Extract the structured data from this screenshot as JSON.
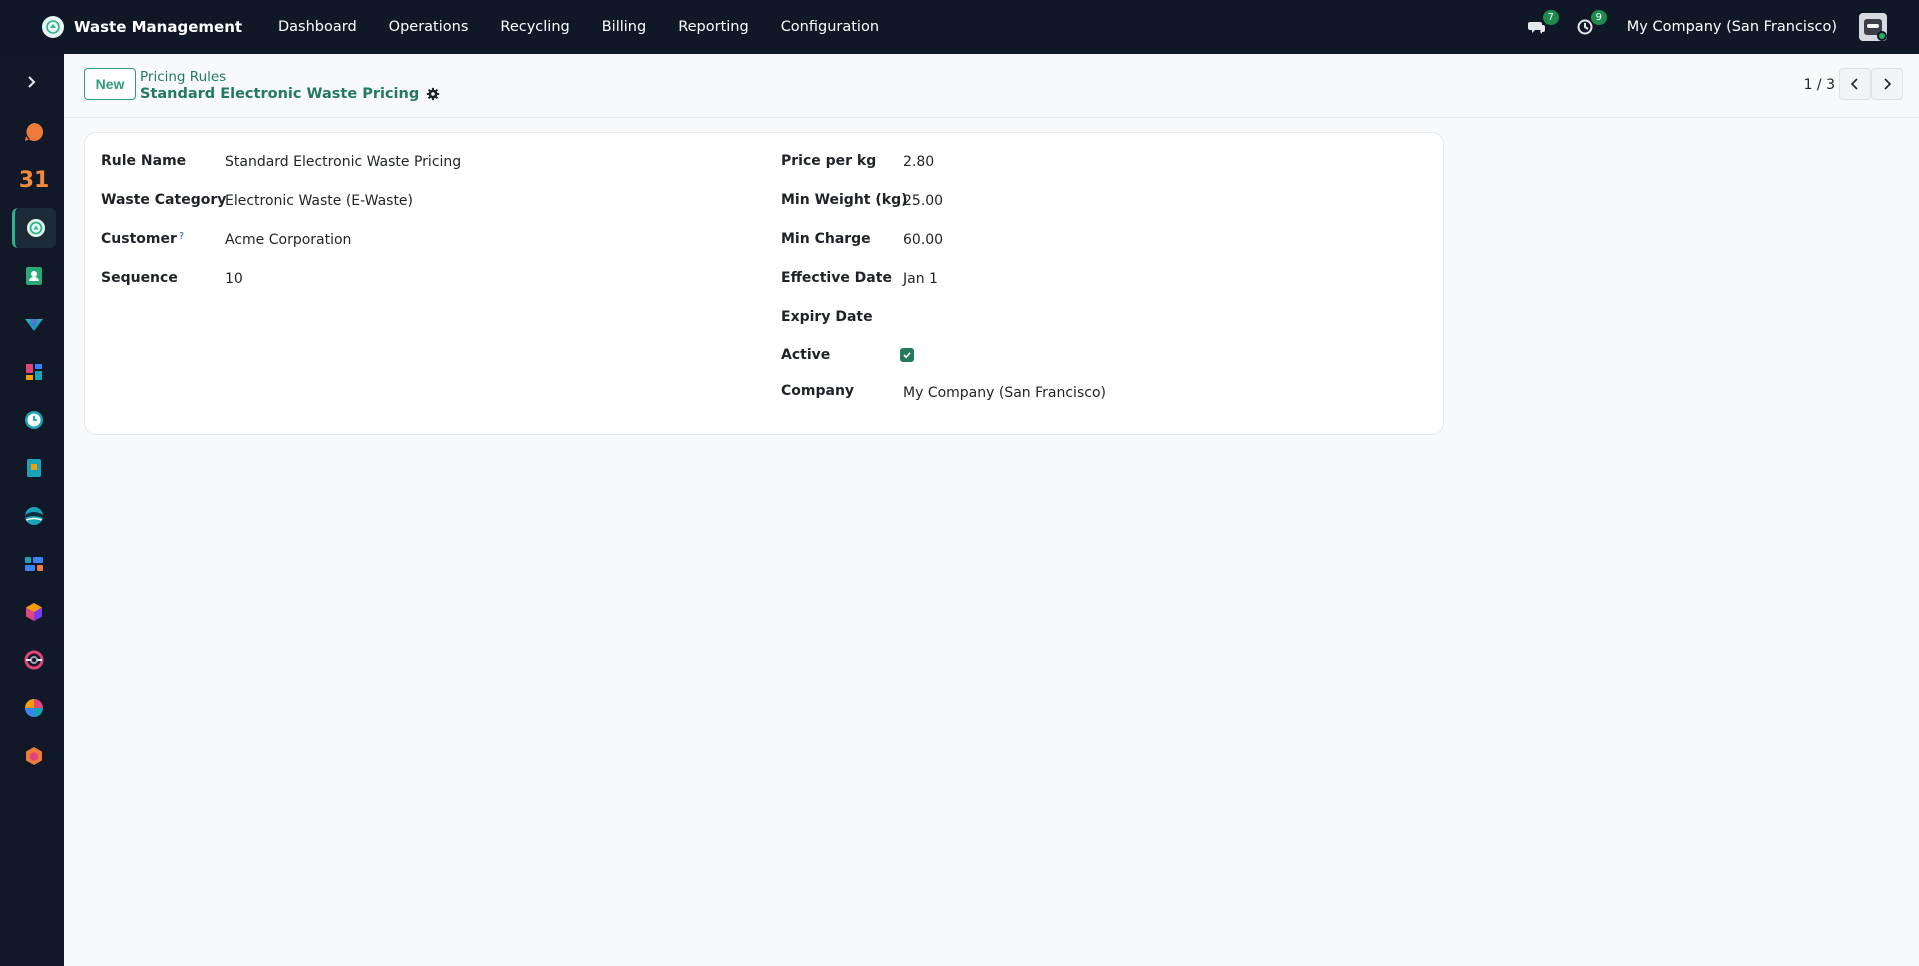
{
  "navbar": {
    "app_name": "Waste Management",
    "menu": [
      "Dashboard",
      "Operations",
      "Recycling",
      "Billing",
      "Reporting",
      "Configuration"
    ],
    "messages_count": "7",
    "activities_count": "9",
    "company": "My Company (San Francisco)"
  },
  "sidebar": {
    "apps": [
      "discuss",
      "calendar",
      "waste-management",
      "contacts",
      "crm",
      "dashboards",
      "timesheets",
      "documents",
      "website",
      "project",
      "inventory",
      "helpdesk",
      "spreadsheet",
      "field-service"
    ],
    "calendar_label": "31"
  },
  "control": {
    "new_label": "New",
    "breadcrumb_parent": "Pricing Rules",
    "breadcrumb_current": "Standard Electronic Waste Pricing",
    "pager": "1 / 3"
  },
  "form": {
    "left": [
      {
        "label": "Rule Name",
        "value": "Standard Electronic Waste Pricing"
      },
      {
        "label": "Waste Category",
        "value": "Electronic Waste (E-Waste)"
      },
      {
        "label": "Customer",
        "value": "Acme Corporation",
        "help": "?"
      },
      {
        "label": "Sequence",
        "value": "10"
      }
    ],
    "right": [
      {
        "label": "Price per kg",
        "value": "2.80"
      },
      {
        "label": "Min Weight (kg)",
        "value": "25.00"
      },
      {
        "label": "Min Charge",
        "value": "60.00"
      },
      {
        "label": "Effective Date",
        "value": "Jan 1"
      },
      {
        "label": "Expiry Date",
        "value": ""
      },
      {
        "label": "Active",
        "checked": true
      },
      {
        "label": "Company",
        "value": "My Company (San Francisco)"
      }
    ]
  },
  "colors": {
    "navbar_bg": "#0f1826",
    "accent": "#237a5e",
    "badge": "#1f8a4c"
  }
}
